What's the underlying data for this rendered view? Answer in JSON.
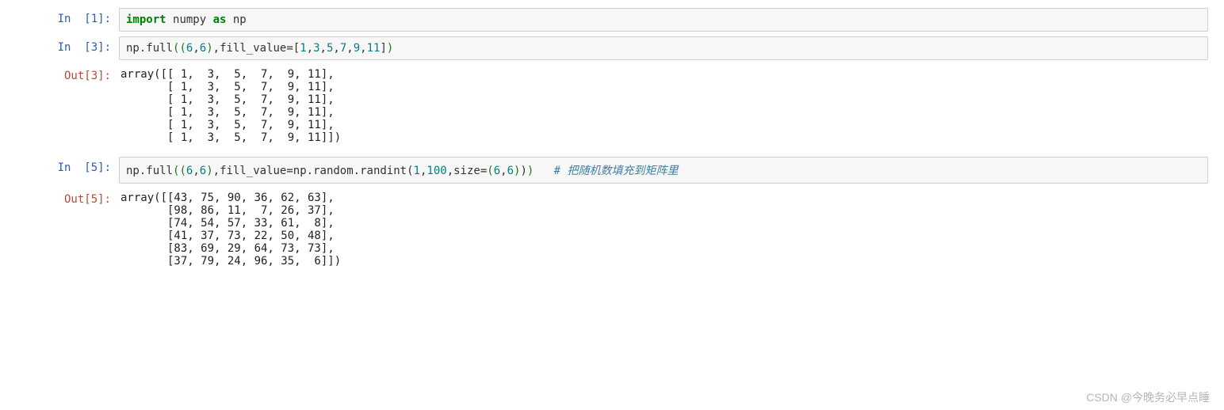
{
  "cells": [
    {
      "in_prompt": "In  [1]:",
      "code_tokens": [
        {
          "t": "import",
          "c": "kw-green"
        },
        {
          "t": " "
        },
        {
          "t": "numpy "
        },
        {
          "t": "as",
          "c": "kw-green"
        },
        {
          "t": " np"
        }
      ]
    },
    {
      "in_prompt": "In  [3]:",
      "code_tokens": [
        {
          "t": "np.full"
        },
        {
          "t": "(",
          "c": "paren-g"
        },
        {
          "t": "(",
          "c": "paren-g"
        },
        {
          "t": "6",
          "c": "num"
        },
        {
          "t": ","
        },
        {
          "t": "6",
          "c": "num"
        },
        {
          "t": ")",
          "c": "paren-g"
        },
        {
          "t": ",fill_value"
        },
        {
          "t": "="
        },
        {
          "t": "["
        },
        {
          "t": "1",
          "c": "num"
        },
        {
          "t": ","
        },
        {
          "t": "3",
          "c": "num"
        },
        {
          "t": ","
        },
        {
          "t": "5",
          "c": "num"
        },
        {
          "t": ","
        },
        {
          "t": "7",
          "c": "num"
        },
        {
          "t": ","
        },
        {
          "t": "9",
          "c": "num"
        },
        {
          "t": ","
        },
        {
          "t": "11",
          "c": "num"
        },
        {
          "t": "]"
        },
        {
          "t": ")",
          "c": "paren-g"
        }
      ],
      "out_prompt": "Out[3]:",
      "output": "array([[ 1,  3,  5,  7,  9, 11],\n       [ 1,  3,  5,  7,  9, 11],\n       [ 1,  3,  5,  7,  9, 11],\n       [ 1,  3,  5,  7,  9, 11],\n       [ 1,  3,  5,  7,  9, 11],\n       [ 1,  3,  5,  7,  9, 11]])"
    },
    {
      "in_prompt": "In  [5]:",
      "code_tokens": [
        {
          "t": "np.full"
        },
        {
          "t": "(",
          "c": "paren-g"
        },
        {
          "t": "(",
          "c": "paren-g"
        },
        {
          "t": "6",
          "c": "num"
        },
        {
          "t": ","
        },
        {
          "t": "6",
          "c": "num"
        },
        {
          "t": ")",
          "c": "paren-g"
        },
        {
          "t": ",fill_value"
        },
        {
          "t": "="
        },
        {
          "t": "np.random.randint"
        },
        {
          "t": "("
        },
        {
          "t": "1",
          "c": "num"
        },
        {
          "t": ","
        },
        {
          "t": "100",
          "c": "num"
        },
        {
          "t": ",size"
        },
        {
          "t": "="
        },
        {
          "t": "(",
          "c": "paren-g"
        },
        {
          "t": "6",
          "c": "num"
        },
        {
          "t": ","
        },
        {
          "t": "6",
          "c": "num"
        },
        {
          "t": ")",
          "c": "paren-g"
        },
        {
          "t": ")"
        },
        {
          "t": ")",
          "c": "paren-g"
        },
        {
          "t": "   "
        },
        {
          "t": "# 把随机数填充到矩阵里",
          "c": "comment"
        }
      ],
      "out_prompt": "Out[5]:",
      "output": "array([[43, 75, 90, 36, 62, 63],\n       [98, 86, 11,  7, 26, 37],\n       [74, 54, 57, 33, 61,  8],\n       [41, 37, 73, 22, 50, 48],\n       [83, 69, 29, 64, 73, 73],\n       [37, 79, 24, 96, 35,  6]])"
    }
  ],
  "watermark": "CSDN @今晚务必早点睡"
}
